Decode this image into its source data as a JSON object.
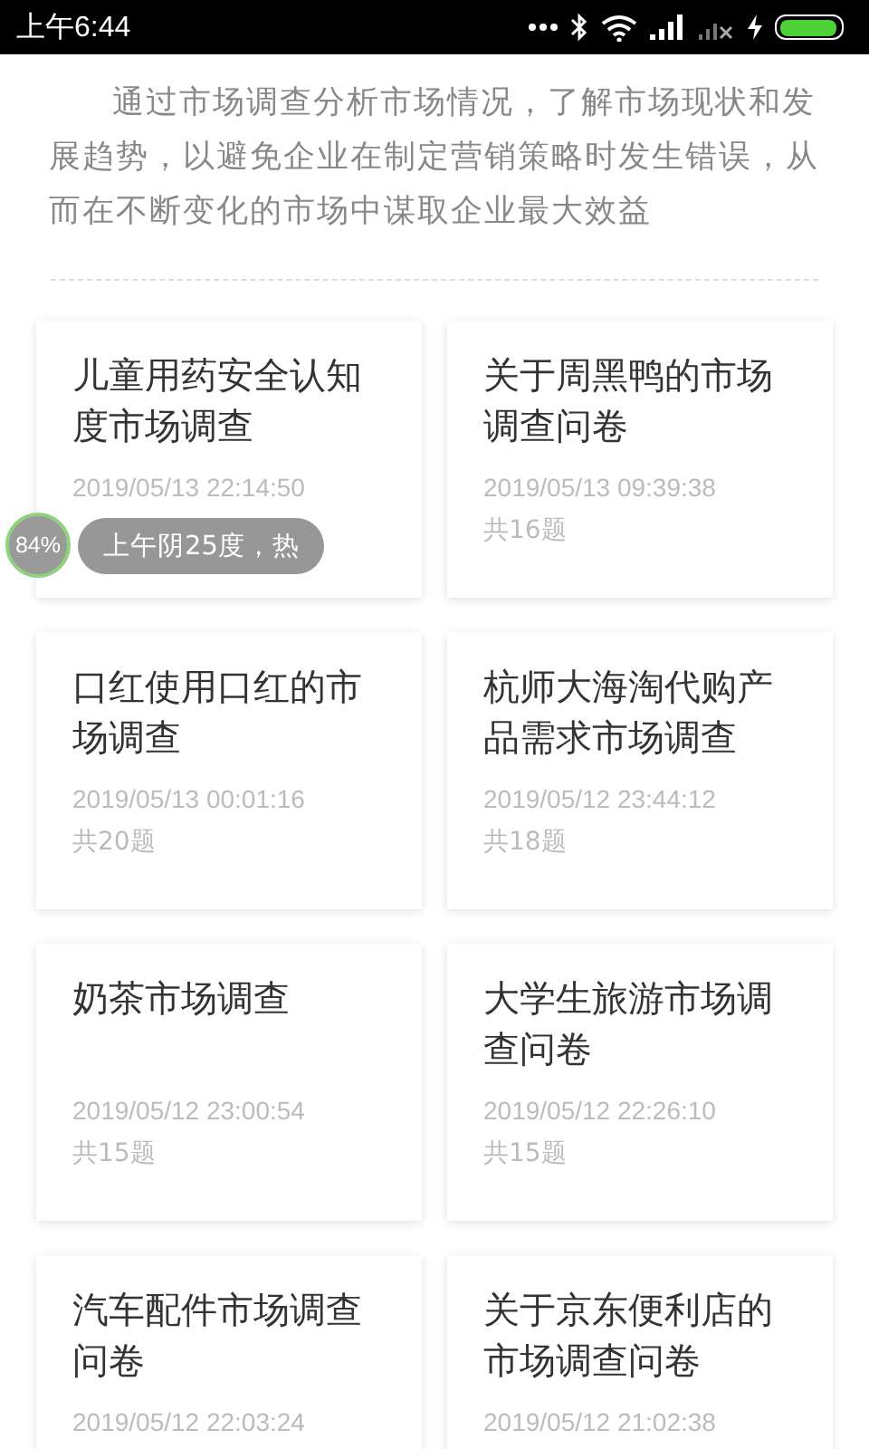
{
  "status_bar": {
    "time": "上午6:44",
    "battery_charging": true,
    "battery": {
      "level": 0.95
    }
  },
  "intro": "通过市场调查分析市场情况，了解市场现状和发展趋势，以避免企业在制定营销策略时发生错误，从而在不断变化的市场中谋取企业最大效益",
  "surveys": [
    {
      "title": "儿童用药安全认知度市场调查",
      "date": "2019/05/13 22:14:50"
    },
    {
      "title": "关于周黑鸭的市场调查问卷",
      "date": "2019/05/13 09:39:38",
      "count": "共16题"
    },
    {
      "title": "口红使用口红的市场调查",
      "date": "2019/05/13 00:01:16",
      "count": "共20题"
    },
    {
      "title": "杭师大海淘代购产品需求市场调查",
      "date": "2019/05/12 23:44:12",
      "count": "共18题"
    },
    {
      "title": "奶茶市场调查",
      "date": "2019/05/12 23:00:54",
      "count": "共15题"
    },
    {
      "title": "大学生旅游市场调查问卷",
      "date": "2019/05/12 22:26:10",
      "count": "共15题"
    },
    {
      "title": "汽车配件市场调查问卷",
      "date": "2019/05/12 22:03:24"
    },
    {
      "title": "关于京东便利店的市场调查问卷",
      "date": "2019/05/12 21:02:38"
    }
  ],
  "floating_widget": {
    "percent": "84%",
    "weather": "上午阴25度，热"
  }
}
